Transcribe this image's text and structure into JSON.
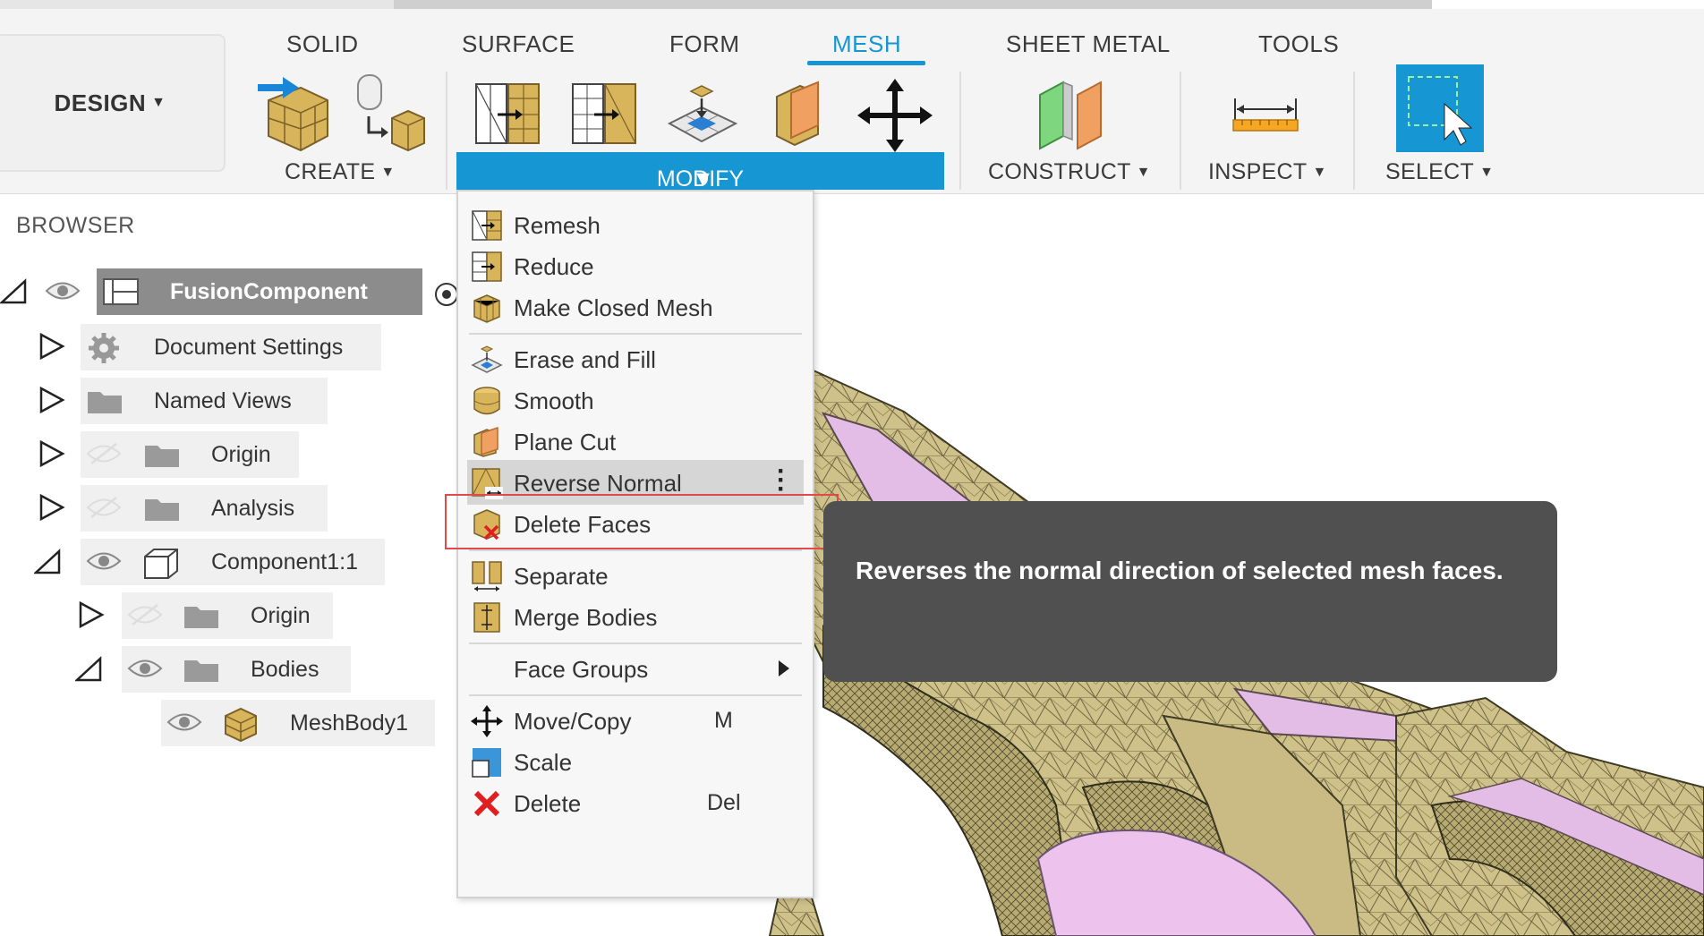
{
  "toolbar": {
    "design_label": "DESIGN",
    "tabs": [
      {
        "label": "SOLID",
        "active": false
      },
      {
        "label": "SURFACE",
        "active": false
      },
      {
        "label": "FORM",
        "active": false
      },
      {
        "label": "MESH",
        "active": true
      },
      {
        "label": "SHEET METAL",
        "active": false
      },
      {
        "label": "TOOLS",
        "active": false
      }
    ],
    "groups": {
      "create": "CREATE",
      "modify": "MODIFY",
      "construct": "CONSTRUCT",
      "inspect": "INSPECT",
      "select": "SELECT"
    },
    "accent_color": "#1696d2"
  },
  "browser": {
    "header": "BROWSER",
    "items": [
      {
        "label": "FusionComponent"
      },
      {
        "label": "Document Settings"
      },
      {
        "label": "Named Views"
      },
      {
        "label": "Origin"
      },
      {
        "label": "Analysis"
      },
      {
        "label": "Component1:1"
      },
      {
        "label": "Origin"
      },
      {
        "label": "Bodies"
      },
      {
        "label": "MeshBody1"
      }
    ]
  },
  "modify_menu": {
    "items": [
      {
        "label": "Remesh",
        "icon": "remesh-icon"
      },
      {
        "label": "Reduce",
        "icon": "reduce-icon"
      },
      {
        "label": "Make Closed Mesh",
        "icon": "make-closed-mesh-icon"
      },
      {
        "label": "Erase and Fill",
        "icon": "erase-fill-icon"
      },
      {
        "label": "Smooth",
        "icon": "smooth-icon"
      },
      {
        "label": "Plane Cut",
        "icon": "plane-cut-icon"
      },
      {
        "label": "Reverse Normal",
        "icon": "reverse-normal-icon",
        "highlighted": true
      },
      {
        "label": "Delete Faces",
        "icon": "delete-faces-icon"
      },
      {
        "label": "Separate",
        "icon": "separate-icon"
      },
      {
        "label": "Merge Bodies",
        "icon": "merge-bodies-icon"
      },
      {
        "label": "Face Groups",
        "icon": "",
        "submenu": true
      },
      {
        "label": "Move/Copy",
        "icon": "move-icon",
        "shortcut": "M"
      },
      {
        "label": "Scale",
        "icon": "scale-icon"
      },
      {
        "label": "Delete",
        "icon": "delete-icon",
        "shortcut": "Del"
      }
    ]
  },
  "tooltip": {
    "text": "Reverses the normal direction of selected mesh faces."
  }
}
